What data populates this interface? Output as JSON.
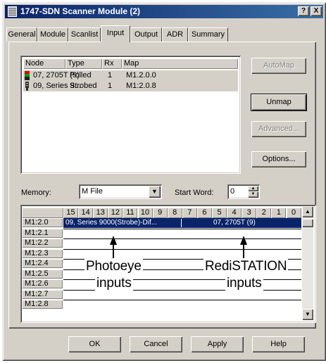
{
  "window": {
    "title": "1747-SDN Scanner Module (2)",
    "help_glyph": "?",
    "close_glyph": "X"
  },
  "tabs": [
    {
      "label": "General"
    },
    {
      "label": "Module"
    },
    {
      "label": "Scanlist"
    },
    {
      "label": "Input"
    },
    {
      "label": "Output"
    },
    {
      "label": "ADR"
    },
    {
      "label": "Summary"
    }
  ],
  "node_list": {
    "columns": [
      "Node",
      "Type",
      "Rx",
      "Map"
    ],
    "rows": [
      {
        "node": "07, 2705T (9)",
        "type": "Polled",
        "rx": "1",
        "map": "M1.2.0.0",
        "icon": "stacklight-icon"
      },
      {
        "node": "09, Series 9...",
        "type": "Strobed",
        "rx": "1",
        "map": "M1:2.0.8",
        "icon": "photoeye-icon"
      }
    ]
  },
  "side_buttons": {
    "automap": "AutoMap",
    "unmap": "Unmap",
    "advanced": "Advanced...",
    "options": "Options..."
  },
  "memory": {
    "label": "Memory:",
    "value": "M File",
    "start_word_label": "Start Word:",
    "start_word_value": "0"
  },
  "bit_grid": {
    "bits": [
      "15",
      "14",
      "13",
      "12",
      "11",
      "10",
      "9",
      "8",
      "7",
      "6",
      "5",
      "4",
      "3",
      "2",
      "1",
      "0"
    ],
    "rows": [
      "M1:2.0",
      "M1:2.1",
      "M1:2.2",
      "M1:2.3",
      "M1:2.4",
      "M1:2.5",
      "M1:2.6",
      "M1:2.7",
      "M1:2.8"
    ],
    "row0_left": "09, Series 9000(Strobe)-Dif...",
    "row0_right": "07, 2705T (9)"
  },
  "annotations": {
    "photoeye_line1": "Photoeye",
    "photoeye_line2": "inputs",
    "rediststation_line1": "RediSTATION",
    "rediststation_line2": "inputs"
  },
  "bottom_buttons": {
    "ok": "OK",
    "cancel": "Cancel",
    "apply": "Apply",
    "help": "Help"
  },
  "colors": {
    "title_start": "#0a246a",
    "title_end": "#3a6ea5",
    "selection": "#0a246a",
    "face": "#d4d0c8"
  }
}
